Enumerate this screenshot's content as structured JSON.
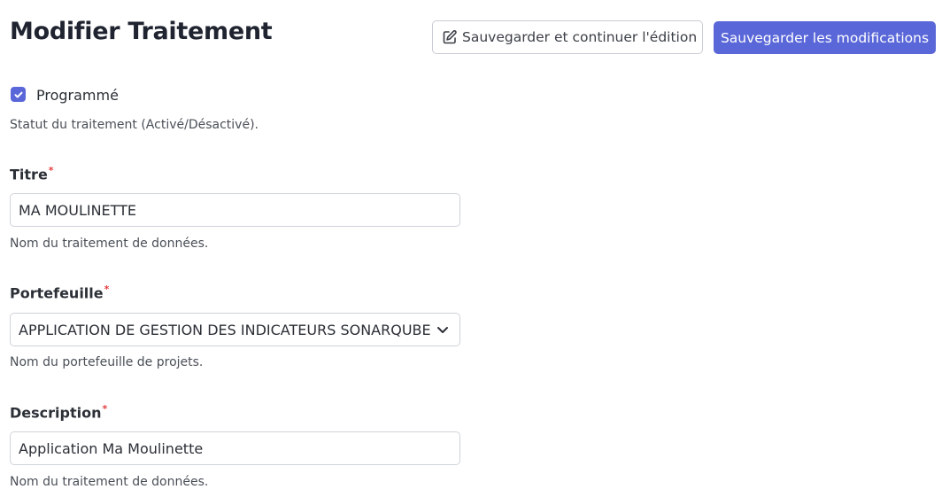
{
  "header": {
    "title": "Modifier Traitement",
    "save_continue_label": "Sauvegarder et continuer l'édition",
    "save_label": "Sauvegarder les modifications"
  },
  "form": {
    "scheduled": {
      "label": "Programmé",
      "checked": true,
      "help": "Statut du traitement (Activé/Désactivé)."
    },
    "title": {
      "label": "Titre",
      "required_mark": "*",
      "value": "MA MOULINETTE",
      "help": "Nom du traitement de données."
    },
    "portfolio": {
      "label": "Portefeuille",
      "required_mark": "*",
      "selected": "APPLICATION DE GESTION DES INDICATEURS SONARQUBE",
      "help": "Nom du portefeuille de projets."
    },
    "description": {
      "label": "Description",
      "required_mark": "*",
      "value": "Application Ma Moulinette",
      "help": "Nom du traitement de données."
    }
  },
  "icons": {
    "edit": "edit-icon",
    "check": "check-icon",
    "chevron": "chevron-down-icon"
  },
  "colors": {
    "primary": "#5a67d8",
    "required": "#e53e3e"
  }
}
